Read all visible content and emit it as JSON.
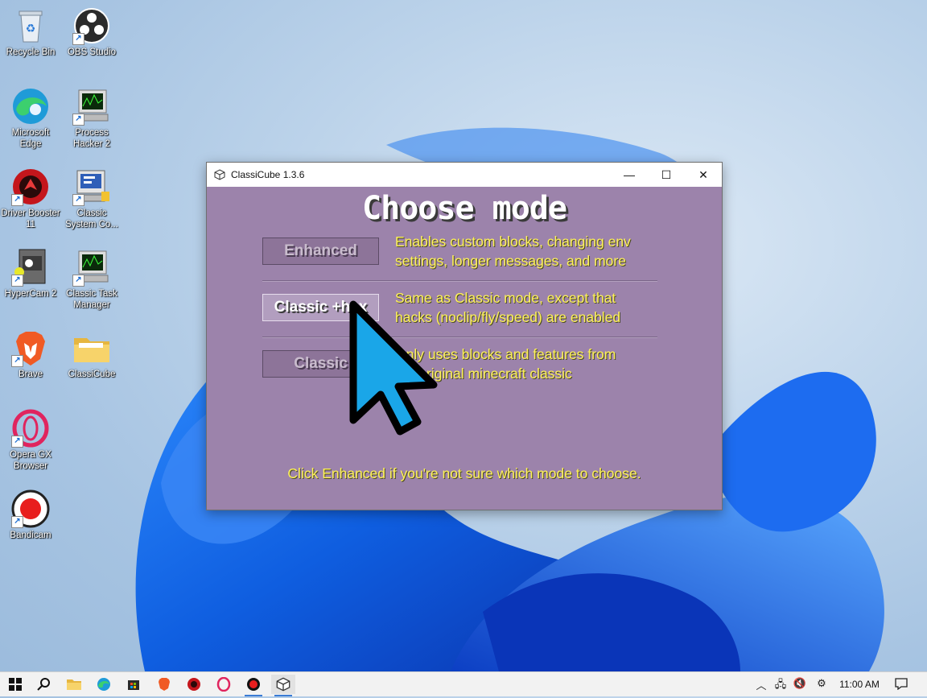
{
  "desktop": {
    "icons": [
      {
        "label": "Recycle Bin",
        "icon": "recycle-bin-icon"
      },
      {
        "label": "OBS Studio",
        "icon": "obs-icon"
      },
      {
        "label": "Microsoft Edge",
        "icon": "edge-icon"
      },
      {
        "label": "Process Hacker 2",
        "icon": "process-hacker-icon"
      },
      {
        "label": "Driver Booster 11",
        "icon": "driver-booster-icon"
      },
      {
        "label": "Classic System Co...",
        "icon": "system-config-icon"
      },
      {
        "label": "HyperCam 2",
        "icon": "hypercam-icon"
      },
      {
        "label": "Classic Task Manager",
        "icon": "task-manager-icon"
      },
      {
        "label": "Brave",
        "icon": "brave-icon"
      },
      {
        "label": "ClassiCube",
        "icon": "folder-icon"
      },
      {
        "label": "Opera GX Browser",
        "icon": "opera-gx-icon"
      },
      {
        "label": "Bandicam",
        "icon": "bandicam-icon"
      }
    ]
  },
  "window": {
    "title": "ClassiCube 1.3.6",
    "heading": "Choose mode",
    "modes": [
      {
        "label": "Enhanced",
        "desc1": "Enables custom blocks, changing env",
        "desc2": "settings, longer messages, and more"
      },
      {
        "label": "Classic +hax",
        "desc1": "Same as Classic mode, except that",
        "desc2": "hacks (noclip/fly/speed) are enabled"
      },
      {
        "label": "Classic",
        "desc1": "Only uses blocks and features from",
        "desc2": "the original minecraft classic"
      }
    ],
    "footer": "Click Enhanced if you're not sure which mode to choose."
  },
  "taskbar": {
    "clock": "11:00 AM"
  },
  "colors": {
    "window_bg": "#9c83ab",
    "desc_text": "#fff25a",
    "taskbar_bg": "#f2f2f2"
  }
}
